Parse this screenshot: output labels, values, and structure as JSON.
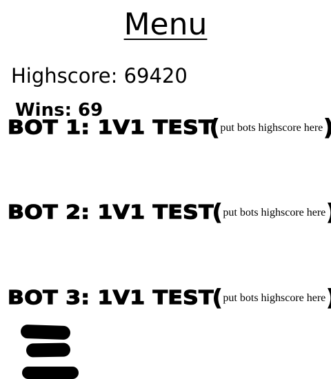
{
  "menu": {
    "title": "Menu"
  },
  "stats": {
    "highscore_label": "Highscore: 69420",
    "wins_label": "Wins: 69"
  },
  "bots": [
    {
      "label": "BOT 1: 1V1 TEST ",
      "score_placeholder": "put bots highscore here"
    },
    {
      "label": "BOT 2: 1V1 TEST ",
      "score_placeholder": "put bots highscore here"
    },
    {
      "label": "BOT 3: 1V1 TEST ",
      "score_placeholder": "put bots highscore here"
    }
  ],
  "paren_open": "(",
  "paren_close": ")",
  "colors": {
    "background": "#ffffff",
    "text": "#000000"
  }
}
